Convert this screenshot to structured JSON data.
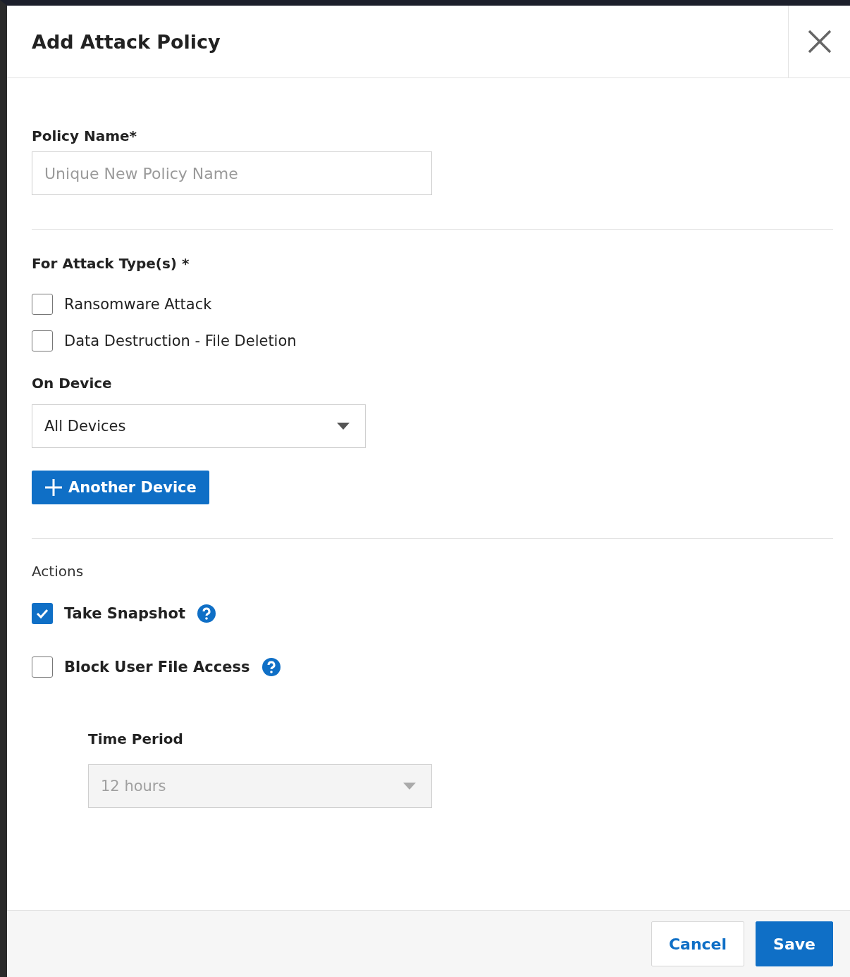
{
  "dialog": {
    "title": "Add Attack Policy"
  },
  "policy_name": {
    "label": "Policy Name*",
    "placeholder": "Unique New Policy Name"
  },
  "attack_types": {
    "label": "For Attack Type(s) *",
    "options": [
      {
        "label": "Ransomware Attack",
        "checked": false
      },
      {
        "label": "Data Destruction - File Deletion",
        "checked": false
      }
    ]
  },
  "device": {
    "label": "On Device",
    "value": "All Devices",
    "add_button": "Another Device"
  },
  "actions": {
    "label": "Actions",
    "options": [
      {
        "label": "Take Snapshot",
        "checked": true
      },
      {
        "label": "Block User File Access",
        "checked": false
      }
    ]
  },
  "time_period": {
    "label": "Time Period",
    "value": "12 hours",
    "disabled": true
  },
  "buttons": {
    "cancel": "Cancel",
    "save": "Save"
  }
}
